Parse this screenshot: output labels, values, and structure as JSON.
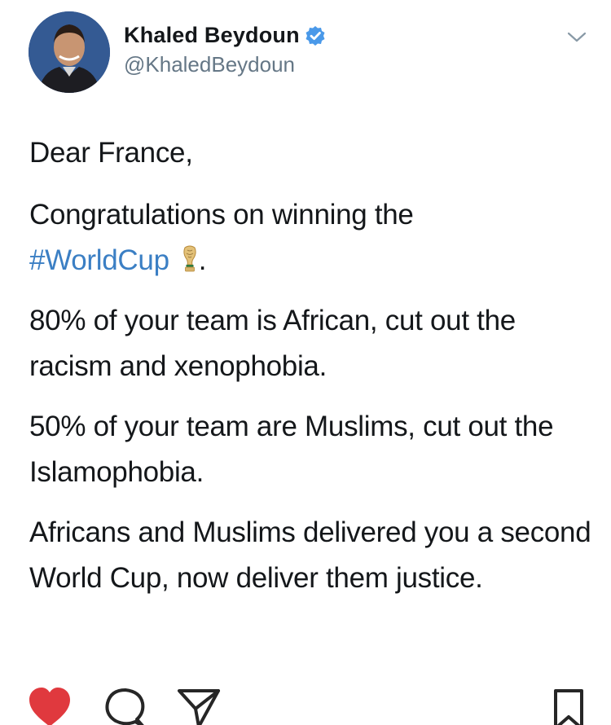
{
  "user": {
    "display_name": "Khaled Beydoun",
    "handle": "@KhaledBeydoun",
    "verified": true
  },
  "tweet": {
    "greeting": "Dear France,",
    "congrats_text": "Congratulations on winning the",
    "hashtag": "#WorldCup",
    "emoji": "trophy-icon",
    "congrats_end": ".",
    "paragraph_african": "80% of your team is African, cut out the racism and xenophobia.",
    "paragraph_muslim": "50% of your team are Muslims, cut out the Islamophobia.",
    "paragraph_closing": "Africans and Muslims delivered you a second World Cup, now deliver them justice."
  },
  "actions": {
    "like": "heart-icon",
    "comment": "comment-icon",
    "share": "paper-plane-icon",
    "save": "bookmark-icon"
  },
  "colors": {
    "hashtag": "#3b7fc4",
    "verified": "#4a99e9",
    "like_filled": "#e0393e",
    "text": "#14171a",
    "muted": "#657786"
  }
}
